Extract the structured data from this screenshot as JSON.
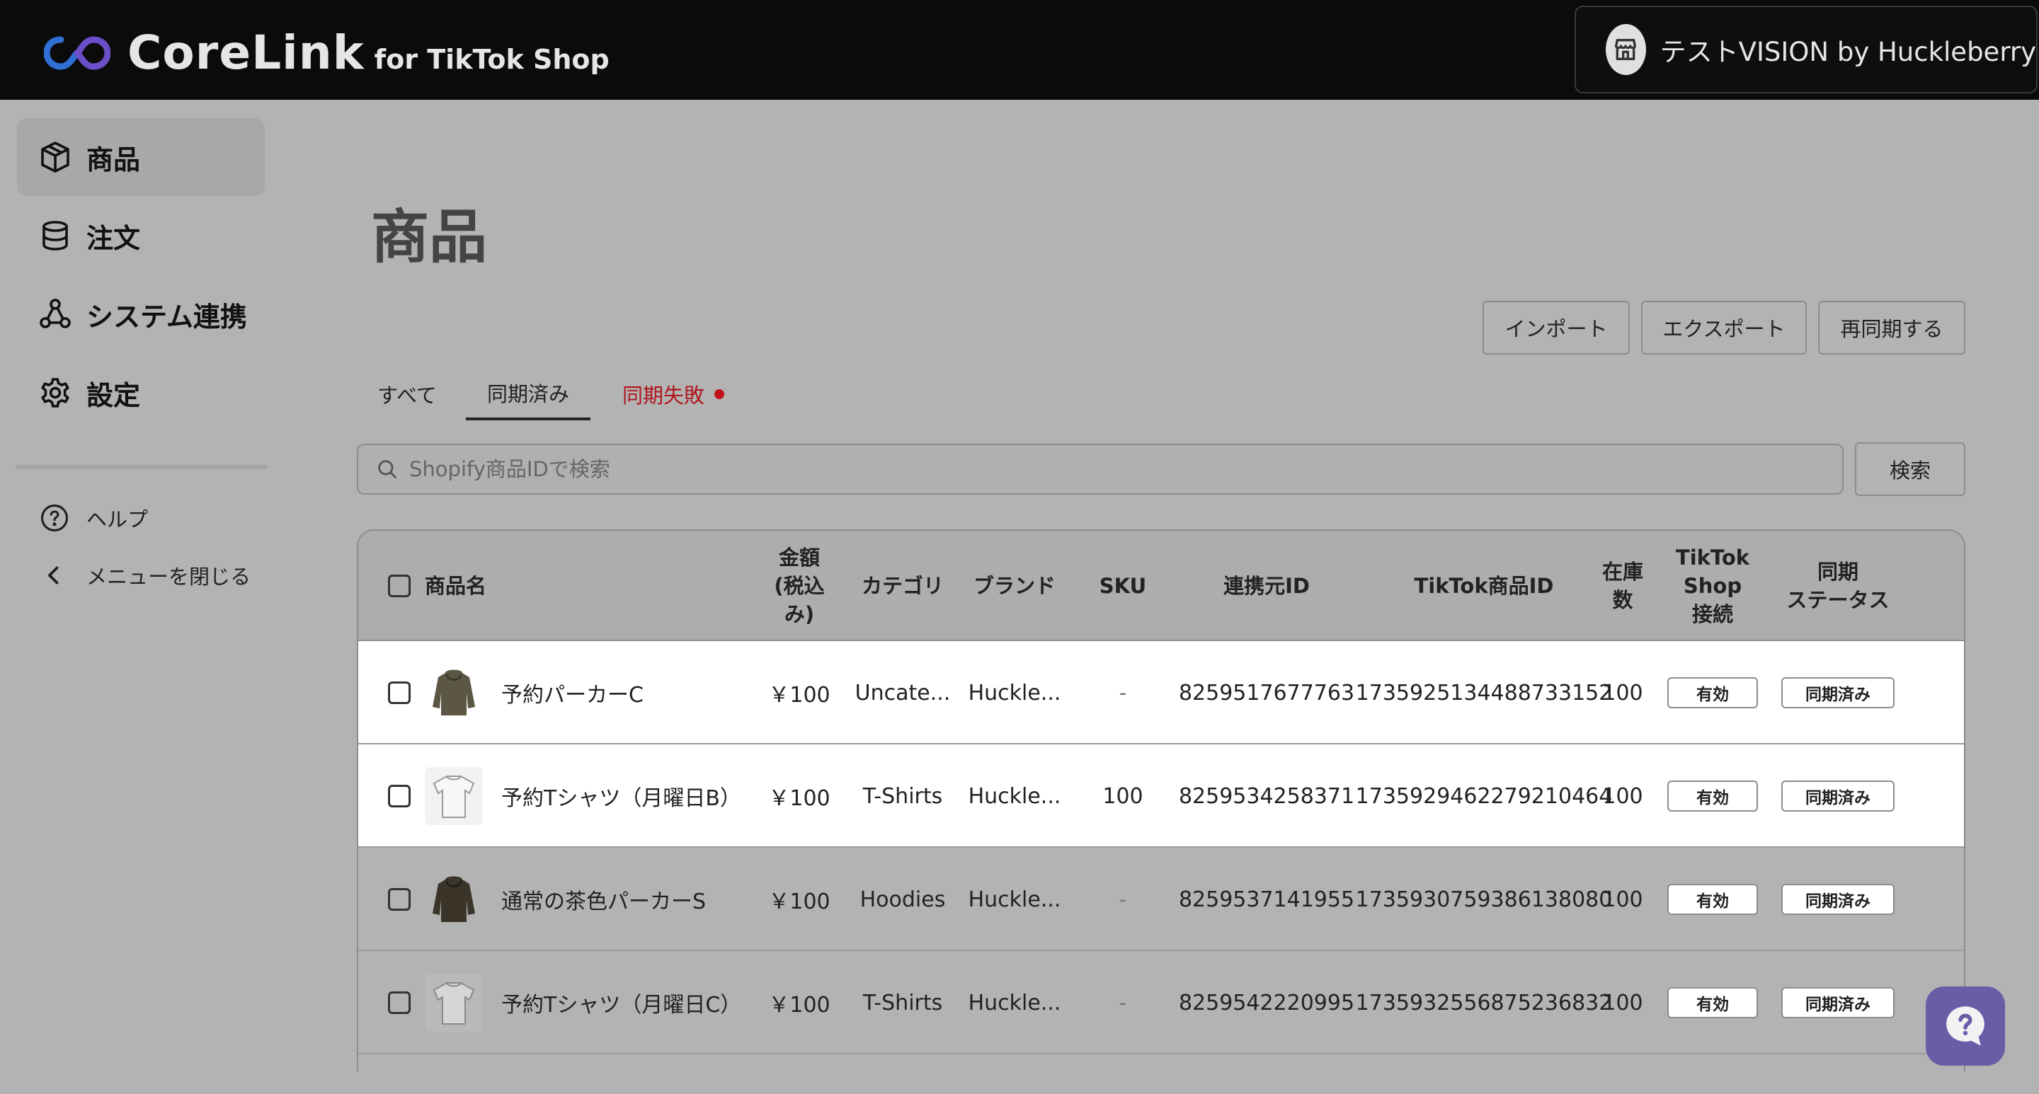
{
  "header": {
    "app_name": "CoreLink",
    "app_sub": "for TikTok Shop",
    "shop_name": "テストVISION by Huckleberry"
  },
  "sidebar": {
    "items": [
      {
        "label": "商品",
        "icon": "box-icon"
      },
      {
        "label": "注文",
        "icon": "database-icon"
      },
      {
        "label": "システム連携",
        "icon": "share-nodes-icon"
      },
      {
        "label": "設定",
        "icon": "gear-icon"
      }
    ],
    "help_label": "ヘルプ",
    "close_menu_label": "メニューを閉じる"
  },
  "main": {
    "title": "商品",
    "actions": {
      "import_label": "インポート",
      "export_label": "エクスポート",
      "resync_label": "再同期する"
    },
    "tabs": [
      {
        "label": "すべて"
      },
      {
        "label": "同期済み"
      },
      {
        "label": "同期失敗"
      }
    ],
    "search": {
      "placeholder": "Shopify商品IDで検索",
      "button_label": "検索"
    },
    "table": {
      "headers": {
        "name": "商品名",
        "price": "金額\n(税込\nみ)",
        "category": "カテゴリ",
        "brand": "ブランド",
        "sku": "SKU",
        "source_id": "連携元ID",
        "tiktok_id": "TikTok商品ID",
        "stock": "在庫\n数",
        "connection": "TikTok\nShop\n接続",
        "sync_status": "同期\nステータス"
      },
      "rows": [
        {
          "name": "予約パーカーC",
          "price": "￥100",
          "category": "Uncate...",
          "brand": "Huckle...",
          "sku": "-",
          "source_id": "8259517677763",
          "tiktok_id": "1735925134488733152",
          "stock": "100",
          "connection": "有効",
          "sync_status": "同期済み",
          "thumb": "hoodie-olive"
        },
        {
          "name": "予約Tシャツ（月曜日B）",
          "price": "￥100",
          "category": "T-Shirts",
          "brand": "Huckle...",
          "sku": "100",
          "source_id": "8259534258371",
          "tiktok_id": "1735929462279210464",
          "stock": "100",
          "connection": "有効",
          "sync_status": "同期済み",
          "thumb": "tshirt-white"
        },
        {
          "name": "通常の茶色パーカーS",
          "price": "￥100",
          "category": "Hoodies",
          "brand": "Huckle...",
          "sku": "-",
          "source_id": "8259537141955",
          "tiktok_id": "1735930759386138080",
          "stock": "100",
          "connection": "有効",
          "sync_status": "同期済み",
          "thumb": "hoodie-brown"
        },
        {
          "name": "予約Tシャツ（月曜日C）",
          "price": "￥100",
          "category": "T-Shirts",
          "brand": "Huckle...",
          "sku": "-",
          "source_id": "8259542220995",
          "tiktok_id": "1735932556875236832",
          "stock": "100",
          "connection": "有効",
          "sync_status": "同期済み",
          "thumb": "tshirt-grey"
        }
      ]
    }
  },
  "colors": {
    "topbar": "#0b0b0b",
    "logo_blue": "#2f6fd6",
    "logo_purple": "#6b4fc9",
    "error_red": "#c0121b",
    "help_fab": "#6b5ca8"
  }
}
